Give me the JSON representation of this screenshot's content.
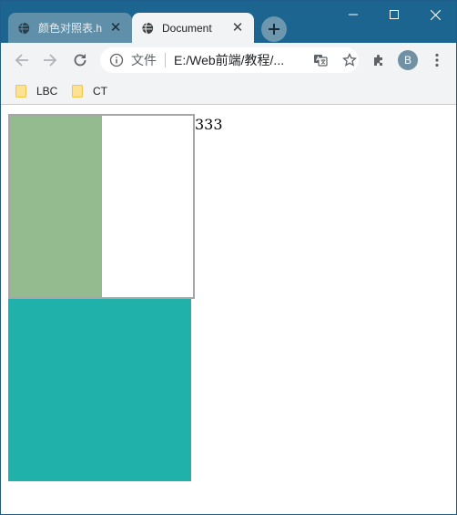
{
  "tabs": [
    {
      "title": "颜色对照表.h",
      "active": false
    },
    {
      "title": "Document",
      "active": true
    }
  ],
  "omnibox": {
    "scheme_label": "文件",
    "url": "E:/Web前端/教程/..."
  },
  "profile": {
    "initial": "B"
  },
  "bookmarks": [
    {
      "label": "LBC"
    },
    {
      "label": "CT"
    }
  ],
  "page": {
    "text_333": "333",
    "box_a_inner_color": "#93bb8f",
    "box_b_color": "#20b2aa"
  },
  "icons": [
    "globe-icon",
    "close-icon",
    "plus-icon",
    "minimize-icon",
    "maximize-icon",
    "window-close-icon",
    "back-icon",
    "forward-icon",
    "reload-icon",
    "info-icon",
    "translate-icon",
    "star-icon",
    "extensions-icon",
    "menu-icon",
    "folder-icon"
  ]
}
